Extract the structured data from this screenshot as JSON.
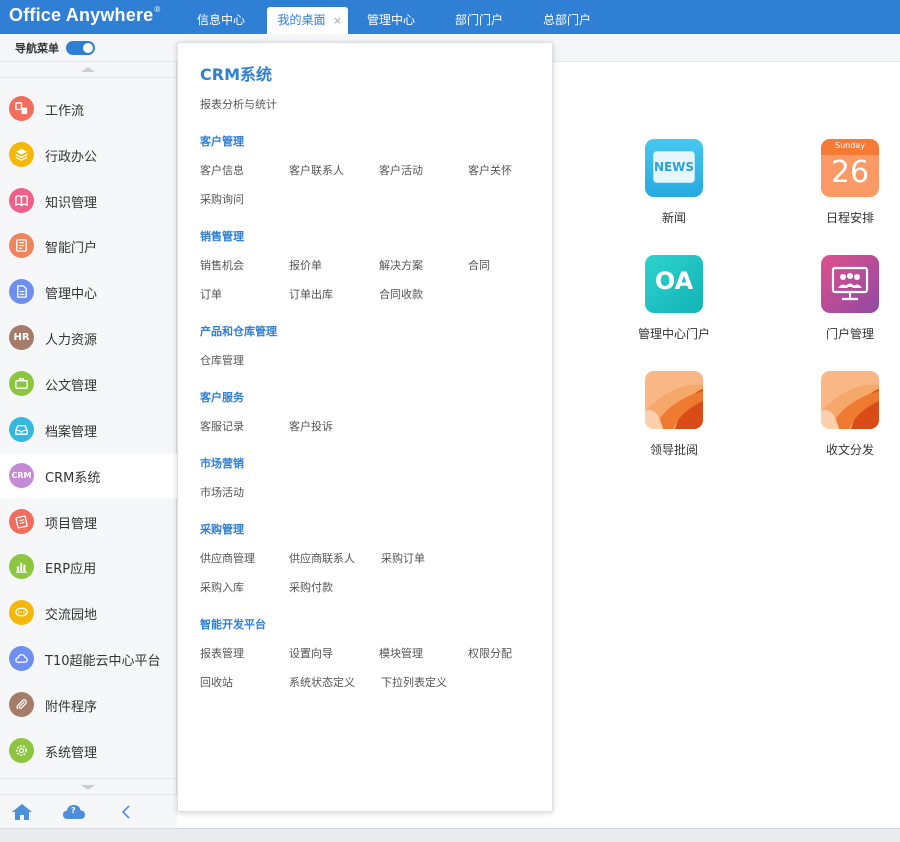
{
  "app": {
    "logo": "Office Anywhere",
    "logo_mark": "®"
  },
  "tabs": [
    {
      "label": "信息中心"
    },
    {
      "label": "我的桌面",
      "active": true
    },
    {
      "label": "管理中心"
    },
    {
      "label": "部门门户"
    },
    {
      "label": "总部门户"
    }
  ],
  "tab_close": "×",
  "subbar": {
    "nav_label": "导航菜单",
    "nav_toggle_on": true
  },
  "sidebar": {
    "items": [
      {
        "label": "工作流",
        "icon": "workflow-icon",
        "color": "#f26d5b"
      },
      {
        "label": "行政办公",
        "icon": "layers-icon",
        "color": "#f5b80a"
      },
      {
        "label": "知识管理",
        "icon": "book-icon",
        "color": "#f0608a"
      },
      {
        "label": "智能门户",
        "icon": "portal-icon",
        "color": "#f0845a"
      },
      {
        "label": "管理中心",
        "icon": "document-icon",
        "color": "#6f8ff0"
      },
      {
        "label": "人力资源",
        "icon": "hr-icon",
        "color": "#a47c68",
        "text": "HR"
      },
      {
        "label": "公文管理",
        "icon": "briefcase-icon",
        "color": "#8cc63f"
      },
      {
        "label": "档案管理",
        "icon": "archive-icon",
        "color": "#35b8e0"
      },
      {
        "label": "CRM系统",
        "icon": "crm-icon",
        "color": "#c58ad6",
        "text": "CRM",
        "active": true
      },
      {
        "label": "项目管理",
        "icon": "project-icon",
        "color": "#f26d5b"
      },
      {
        "label": "ERP应用",
        "icon": "chart-icon",
        "color": "#8cc63f"
      },
      {
        "label": "交流园地",
        "icon": "chat-icon",
        "color": "#f5b80a"
      },
      {
        "label": "T10超能云中心平台",
        "icon": "cloud-icon",
        "color": "#6f8ff0"
      },
      {
        "label": "附件程序",
        "icon": "paperclip-icon",
        "color": "#a47c68"
      },
      {
        "label": "系统管理",
        "icon": "gear-icon",
        "color": "#8cc63f"
      }
    ]
  },
  "sidebar_bottom": {
    "home": "home-icon",
    "cloud": "cloud-help-icon",
    "cloud_mark": "?",
    "collapse": "chevron-left-icon"
  },
  "popup": {
    "title": "CRM系统",
    "subtitle": "报表分析与统计",
    "groups": [
      {
        "title": "客户管理",
        "links": [
          "客户信息",
          "客户联系人",
          "客户活动",
          "客户关怀",
          "采购询问"
        ]
      },
      {
        "title": "销售管理",
        "links": [
          "销售机会",
          "报价单",
          "解决方案",
          "合同",
          "订单",
          "订单出库",
          "合同收款"
        ]
      },
      {
        "title": "产品和仓库管理",
        "links": [
          "仓库管理"
        ]
      },
      {
        "title": "客户服务",
        "links": [
          "客服记录",
          "客户投诉"
        ]
      },
      {
        "title": "市场营销",
        "links": [
          "市场活动"
        ]
      },
      {
        "title": "采购管理",
        "links": [
          "供应商管理",
          "供应商联系人",
          "采购订单",
          "采购入库",
          "采购付款"
        ]
      },
      {
        "title": "智能开发平台",
        "links": [
          "报表管理",
          "设置向导",
          "模块管理",
          "权限分配",
          "回收站",
          "系统状态定义",
          "下拉列表定义"
        ]
      }
    ]
  },
  "desktop": [
    {
      "label": "新闻",
      "icon": "news-icon",
      "icon_text": "NEWS"
    },
    {
      "label": "日程安排",
      "icon": "calendar-icon",
      "icon_sub": "Sunday",
      "icon_text": "26"
    },
    {
      "label": "管理中心门户",
      "icon": "oa-icon",
      "icon_text": "OA"
    },
    {
      "label": "门户管理",
      "icon": "portal-manage-icon"
    },
    {
      "label": "领导批阅",
      "icon": "review-icon"
    },
    {
      "label": "收文分发",
      "icon": "receive-doc-icon"
    }
  ]
}
